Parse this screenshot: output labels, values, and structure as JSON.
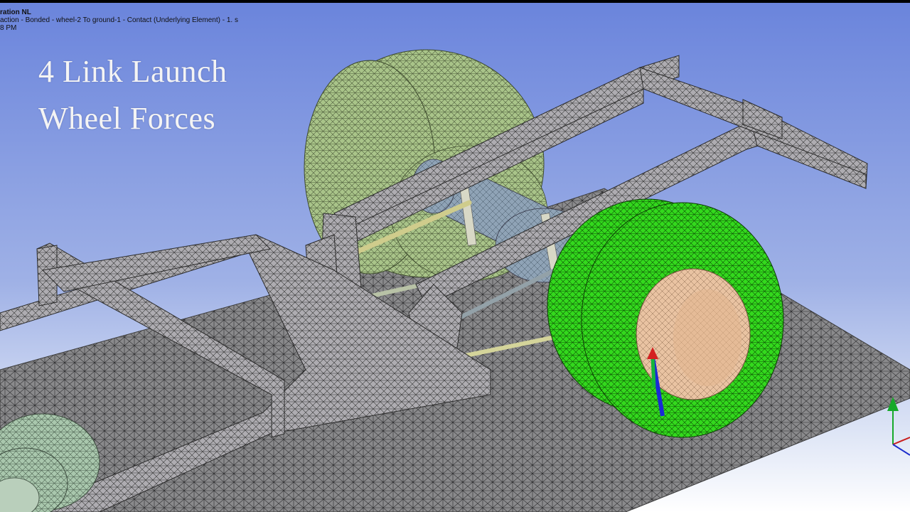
{
  "window": {
    "title": "ration NL",
    "details_line": "action - Bonded - wheel-2 To ground-1 - Contact (Underlying Element) - 1. s",
    "time_line": "8 PM"
  },
  "overlay": {
    "line1": "4 Link Launch",
    "line2": "Wheel Forces"
  },
  "colors": {
    "background_top": "#6e86dc",
    "background_bottom": "#ffffff",
    "mesh_gray": "#8c8c8c",
    "frame_gray": "#a9a7ab",
    "tire_green_highlight": "#33d91d",
    "tire_green_pale": "#a7c388",
    "rim_tan": "#e9c3a2",
    "axle_blue": "#8ea3b5",
    "link_yellow": "#d6d49a"
  },
  "triad": {
    "x_axis": "red",
    "y_axis": "green",
    "z_axis": "blue"
  },
  "icons": [
    "coordinate-triad-icon",
    "small-triad-icon"
  ]
}
